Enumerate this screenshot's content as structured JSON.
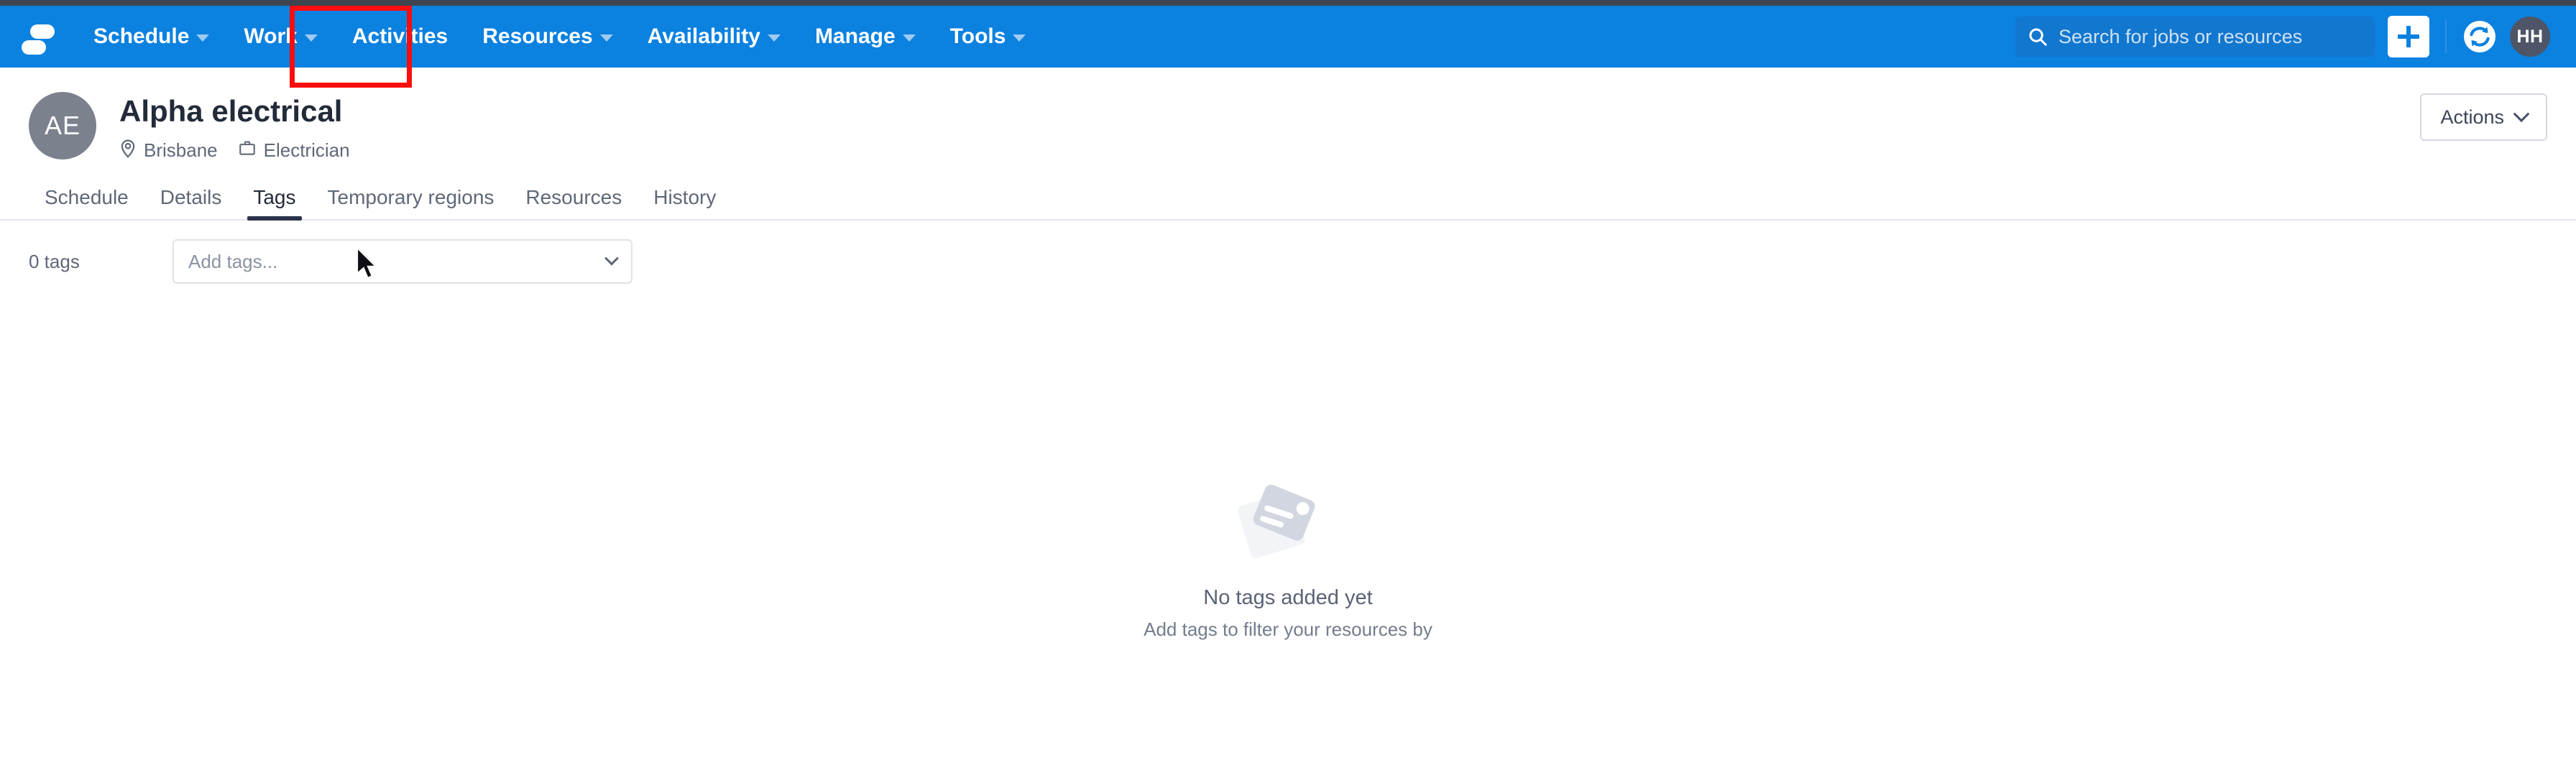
{
  "theme": {
    "navbar_blue": "#0b81e0",
    "top_strip": "#3f4550",
    "highlight_red": "#fb0d0d",
    "avatar_grey": "#7b818d",
    "user_avatar_grey": "#4d5567"
  },
  "navbar": {
    "logo_name": "skedulo-logo",
    "items": [
      {
        "label": "Schedule",
        "has_caret": true
      },
      {
        "label": "Work",
        "has_caret": true
      },
      {
        "label": "Activities",
        "has_caret": false
      },
      {
        "label": "Resources",
        "has_caret": true
      },
      {
        "label": "Availability",
        "has_caret": true
      },
      {
        "label": "Manage",
        "has_caret": true
      },
      {
        "label": "Tools",
        "has_caret": true
      }
    ],
    "search": {
      "placeholder": "Search for jobs or resources",
      "value": "",
      "icon": "search-icon"
    },
    "create_button_icon": "plus-icon",
    "sync_icon": "sync-icon",
    "user_avatar_initials": "HH"
  },
  "header": {
    "avatar_initials": "AE",
    "title": "Alpha electrical",
    "meta": [
      {
        "icon": "map-pin-icon",
        "label": "Brisbane"
      },
      {
        "icon": "briefcase-icon",
        "label": "Electrician"
      }
    ],
    "actions_button": "Actions"
  },
  "tabs": {
    "items": [
      {
        "label": "Schedule",
        "active": false
      },
      {
        "label": "Details",
        "active": false
      },
      {
        "label": "Tags",
        "active": true
      },
      {
        "label": "Temporary regions",
        "active": false
      },
      {
        "label": "Resources",
        "active": false
      },
      {
        "label": "History",
        "active": false
      }
    ],
    "active_label": "Tags"
  },
  "tags_panel": {
    "count_label": "0 tags",
    "select_placeholder": "Add tags...",
    "select_value": "",
    "empty_state": {
      "illustration": "tags-illustration",
      "title": "No tags added yet",
      "subtitle": "Add tags to filter your resources by"
    }
  }
}
